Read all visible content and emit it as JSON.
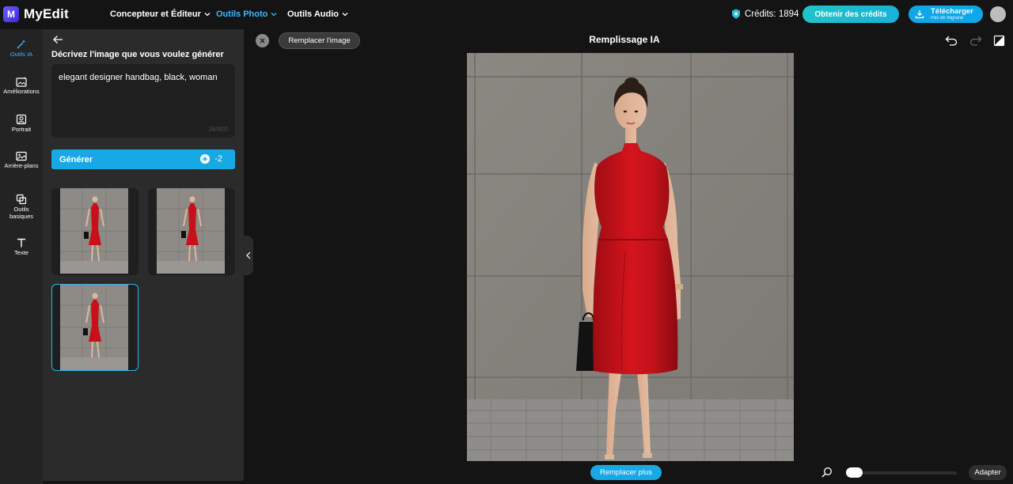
{
  "app": {
    "name": "MyEdit",
    "logo_letter": "M"
  },
  "nav": {
    "items": [
      {
        "label": "Concepteur et Éditeur",
        "active": false
      },
      {
        "label": "Outils Photo",
        "active": true
      },
      {
        "label": "Outils Audio",
        "active": false
      }
    ]
  },
  "header": {
    "credits_text": "Crédits: 1894",
    "get_credits_label": "Obtenir des crédits",
    "download_label": "Télécharger",
    "download_sub": "Pas de filigrane"
  },
  "rail": {
    "items": [
      {
        "label": "Outils IA",
        "icon": "magic-wand-icon",
        "active": true
      },
      {
        "label": "Améliorations",
        "icon": "enhance-image-icon",
        "active": false
      },
      {
        "label": "Portrait",
        "icon": "portrait-icon",
        "active": false
      },
      {
        "label": "Arrière-plans",
        "icon": "background-icon",
        "active": false
      },
      {
        "label": "Outils basiques",
        "icon": "crop-tools-icon",
        "active": false
      },
      {
        "label": "Texte",
        "icon": "text-icon",
        "active": false
      }
    ]
  },
  "panel": {
    "title": "Décrivez l'image que vous voulez générer",
    "prompt_value": "elegant designer handbag, black, woman",
    "char_count": "38/800",
    "generate_label": "Générer",
    "generate_cost": "-2",
    "results": [
      {
        "selected": false
      },
      {
        "selected": false
      },
      {
        "selected": true
      }
    ]
  },
  "canvas": {
    "title": "Remplissage IA",
    "replace_image_label": "Remplacer l'image",
    "replace_more_label": "Remplacer plus",
    "fit_label": "Adapter",
    "zoom_level": 0.0
  },
  "colors": {
    "accent": "#17a9e6",
    "credits_gradient_start": "#22c3c8",
    "background": "#141414",
    "panel": "#2b2b2b",
    "dress": "#c8101a"
  }
}
